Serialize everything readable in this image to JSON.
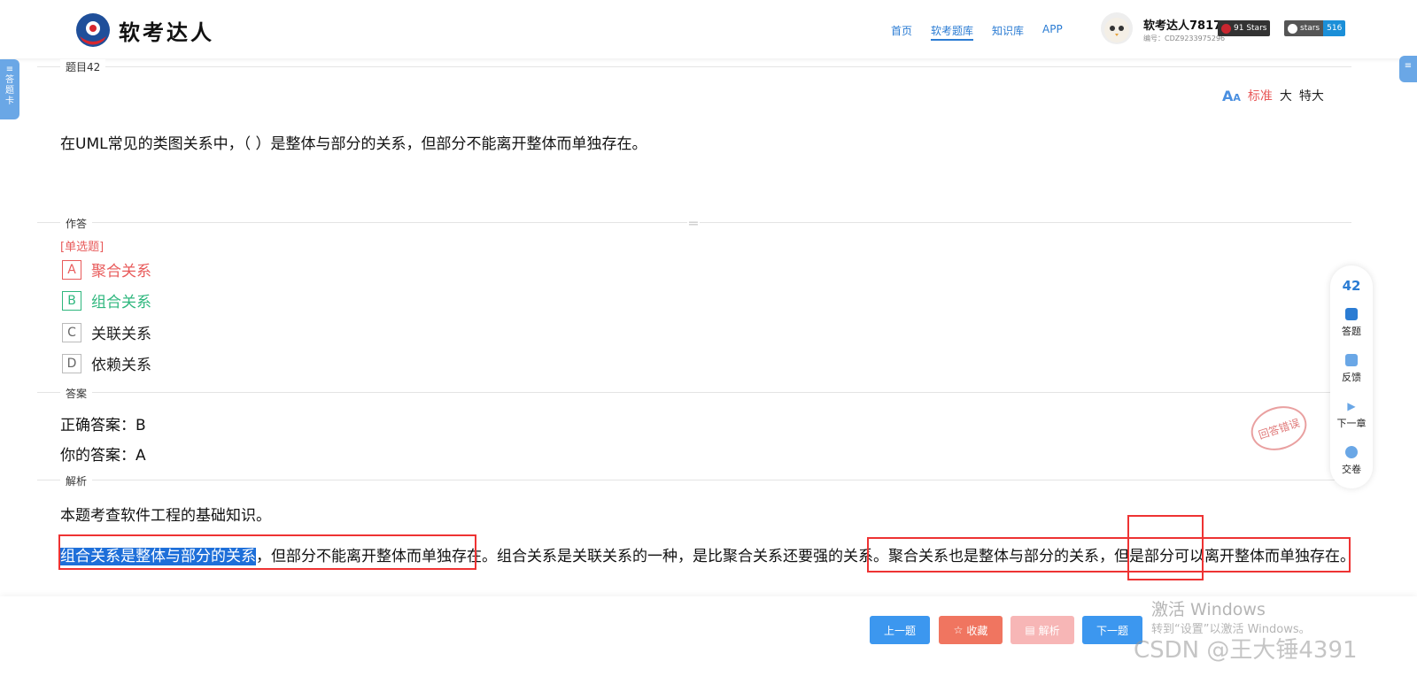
{
  "header": {
    "logo_text": "软考达人",
    "nav": [
      "首页",
      "软考题库",
      "知识库",
      "APP"
    ],
    "active_nav": "软考题库",
    "user_name": "软考达人7817",
    "user_id": "编号：CDZ9233975296",
    "badges": [
      {
        "left": "91 Stars",
        "color": "#c9262f"
      },
      {
        "left": "stars",
        "right": "516",
        "color": "#1b8fd8"
      }
    ]
  },
  "side_tab": {
    "chars": [
      "答",
      "题",
      "卡"
    ]
  },
  "question": {
    "number_label": "题目42",
    "font_sizes": [
      "标准",
      "大",
      "特大"
    ],
    "text": "在UML常见的类图关系中，（ ）是整体与部分的关系，但部分不能离开整体而单独存在。"
  },
  "answer_section": {
    "label": "作答",
    "type": "[单选题]",
    "options": [
      {
        "key": "A",
        "text": "聚合关系",
        "state": "wrong"
      },
      {
        "key": "B",
        "text": "组合关系",
        "state": "right"
      },
      {
        "key": "C",
        "text": "关联关系",
        "state": "normal"
      },
      {
        "key": "D",
        "text": "依赖关系",
        "state": "normal"
      }
    ]
  },
  "result_section": {
    "label": "答案",
    "correct": "正确答案：B",
    "yours": "你的答案：A",
    "stamp": "回答错误"
  },
  "analysis_section": {
    "label": "解析",
    "intro": "本题考查软件工程的基础知识。",
    "highlighted": "组合关系是整体与部分的关系",
    "rest": "，但部分不能离开整体而单独存在。组合关系是关联关系的一种，是比聚合关系还要强的关系。聚合关系也是整体与部分的关系，但是部分可以离开整体而单独存在。"
  },
  "toolbar": {
    "number": "42",
    "items": [
      "答题",
      "反馈",
      "下一章",
      "交卷"
    ]
  },
  "bottom_buttons": [
    "上一题",
    "收藏",
    "解析",
    "下一题"
  ],
  "watermarks": {
    "win1": "激活 Windows",
    "win2": "转到“设置”以激活 Windows。",
    "csdn": "CSDN @王大锤4391"
  },
  "colors": {
    "accent": "#2b7cd3",
    "wrong": "#e85b5b",
    "right": "#2fb77e"
  }
}
